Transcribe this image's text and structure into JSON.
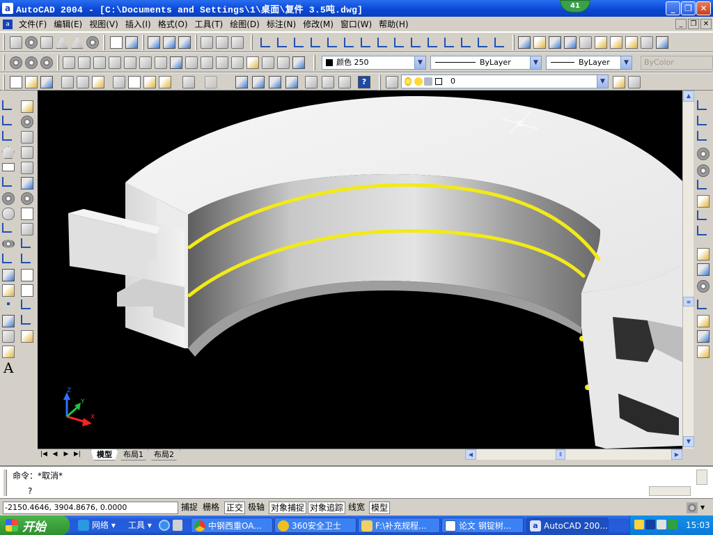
{
  "window": {
    "title": "AutoCAD 2004 - [C:\\Documents and Settings\\1\\桌面\\复件 3.5吨.dwg]",
    "app_icon": "a",
    "notification_badge": "41"
  },
  "menu": {
    "items": [
      "文件(F)",
      "编辑(E)",
      "视图(V)",
      "插入(I)",
      "格式(O)",
      "工具(T)",
      "绘图(D)",
      "标注(N)",
      "修改(M)",
      "窗口(W)",
      "帮助(H)"
    ]
  },
  "properties": {
    "color_value": "颜色 250",
    "linetype_value": "ByLayer",
    "lineweight_value": "ByLayer",
    "plotstyle_value": "ByColor",
    "layer_value": "0"
  },
  "ucs": {
    "x": "X",
    "y": "Y",
    "z": "Z"
  },
  "tabs": {
    "model": "模型",
    "layout1": "布局1",
    "layout2": "布局2"
  },
  "command": {
    "history_line": "命令：*取消*",
    "prompt_line": "?"
  },
  "status": {
    "coords": "-2150.4646, 3904.8676, 0.0000",
    "toggles": [
      {
        "label": "捕捉",
        "on": false
      },
      {
        "label": "栅格",
        "on": false
      },
      {
        "label": "正交",
        "on": true
      },
      {
        "label": "极轴",
        "on": false
      },
      {
        "label": "对象捕捉",
        "on": true
      },
      {
        "label": "对象追踪",
        "on": true
      },
      {
        "label": "线宽",
        "on": false
      },
      {
        "label": "模型",
        "on": true
      }
    ]
  },
  "taskbar": {
    "start_label": "开始",
    "quick": {
      "network": "网络",
      "tools": "工具"
    },
    "buttons": [
      {
        "label": "中钢西重OA...",
        "color": "#e04030"
      },
      {
        "label": "360安全卫士",
        "color": "#f0c020"
      },
      {
        "label": "F:\\补充规程...",
        "color": "#f0d060"
      },
      {
        "label": "论文 钢锭树...",
        "color": "#ffffff"
      },
      {
        "label": "AutoCAD 200...",
        "color": "#d8e4f8",
        "active": true
      }
    ],
    "clock": "15:03"
  },
  "colors": {
    "model_face": "#f0f0f0",
    "model_shadow": "#8a8a8a",
    "ring_yellow": "#f2ea18",
    "titlebar": "#0a48d8",
    "canvas": "#000000"
  }
}
